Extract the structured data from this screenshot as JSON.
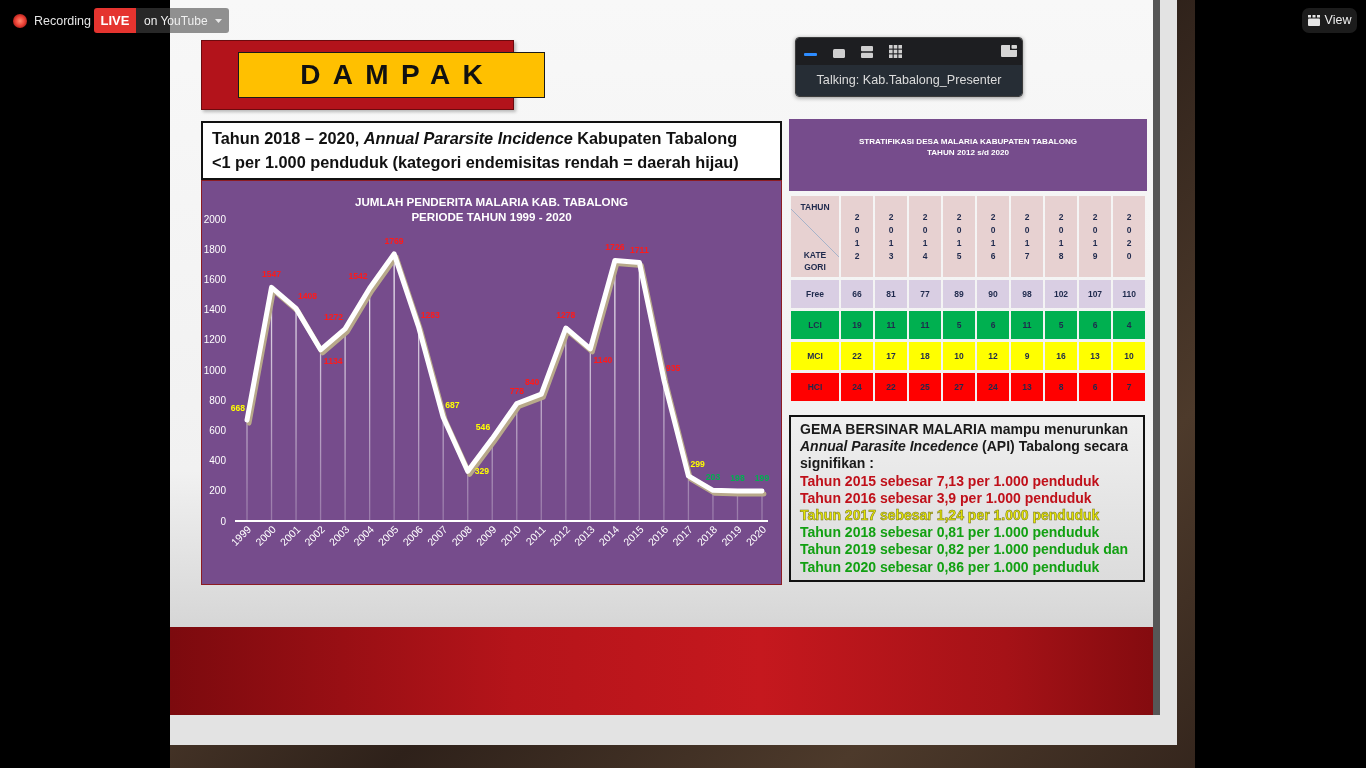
{
  "recording": {
    "label": "Recording"
  },
  "live_stream": {
    "badge": "LIVE",
    "destination": "on YouTube"
  },
  "view_menu": {
    "label": "View"
  },
  "speaker_panel": {
    "view_modes": [
      {
        "kind": "minimize",
        "selected": true
      },
      {
        "kind": "speaker",
        "selected": false
      },
      {
        "kind": "strip",
        "selected": false
      },
      {
        "kind": "gallery",
        "selected": false
      }
    ],
    "talking": "Talking: Kab.Tabalong_Presenter"
  },
  "slide": {
    "title": "DAMPAK",
    "subtitle": "Tahun 2018 – 2020, *Annual Pararsite Incidence* Kabupaten Tabalong <1 per 1.000 penduduk (kategori endemisitas rendah = daerah hijau)",
    "chart": {
      "data_labels": [
        {
          "color": "#ffff00"
        },
        {
          "color": "#ff1a1a"
        },
        {
          "color": "#ff1a1a"
        },
        {
          "color": "#ff1a1a"
        },
        {
          "color": "#ff1a1a"
        },
        {
          "color": "#ff1a1a"
        },
        {
          "color": "#ff1a1a"
        },
        {
          "color": "#ff1a1a"
        },
        {
          "color": "#ffff00"
        },
        {
          "color": "#ffff00"
        },
        {
          "color": "#ffff00"
        },
        {
          "color": "#ff1a1a"
        },
        {
          "color": "#ff1a1a"
        },
        {
          "color": "#ff1a1a"
        },
        {
          "color": "#ff1a1a"
        },
        {
          "color": "#ff1a1a"
        },
        {
          "color": "#ff1a1a"
        },
        {
          "color": "#ff1a1a"
        },
        {
          "color": "#ffff00"
        },
        {
          "color": "#00b050"
        },
        {
          "color": "#00b050"
        },
        {
          "color": "#00b050"
        }
      ],
      "chart_data": {
        "type": "line",
        "title": "JUMLAH PENDERITA MALARIA KAB. TABALONG PERIODE TAHUN 1999 - 2020",
        "categories": [
          "1999",
          "2000",
          "2001",
          "2002",
          "2003",
          "2004",
          "2005",
          "2006",
          "2007",
          "2008",
          "2009",
          "2010",
          "2011",
          "2012",
          "2013",
          "2014",
          "2015",
          "2016",
          "2017",
          "2018",
          "2019",
          "2020"
        ],
        "values": [
          668,
          1547,
          1408,
          1134,
          1272,
          1542,
          1769,
          1283,
          687,
          329,
          546,
          778,
          840,
          1278,
          1140,
          1726,
          1711,
          935,
          299,
          203,
          198,
          199
        ],
        "ylim": [
          0,
          2000
        ],
        "yticks": [
          0,
          200,
          400,
          600,
          800,
          1000,
          1200,
          1400,
          1600,
          1800,
          2000
        ],
        "grid": true,
        "data_labels": true
      }
    },
    "stratification": {
      "title": "STRATIFIKASI DESA MALARIA KABUPATEN TABALONG",
      "subtitle": "TAHUN 2012 s/d 2020",
      "corner_top": "TAHUN",
      "corner_bottom": "KATE GORI",
      "years": [
        "2012",
        "2013",
        "2014",
        "2015",
        "2016",
        "2017",
        "2018",
        "2019",
        "2020"
      ],
      "rows": [
        {
          "category": "Free",
          "color": "#d9cee3",
          "cells": [
            "66",
            "81",
            "77",
            "89",
            "90",
            "98",
            "102",
            "107",
            "110"
          ]
        },
        {
          "category": "LCI",
          "color": "#00b050",
          "cells": [
            "19",
            "11",
            "11",
            "5",
            "6",
            "11",
            "5",
            "6",
            "4"
          ]
        },
        {
          "category": "MCI",
          "color": "#ffff00",
          "cells": [
            "22",
            "17",
            "18",
            "10",
            "12",
            "9",
            "16",
            "13",
            "10"
          ]
        },
        {
          "category": "HCI",
          "color": "#ff0000",
          "cells": [
            "24",
            "22",
            "25",
            "27",
            "24",
            "13",
            "8",
            "6",
            "7"
          ]
        }
      ]
    },
    "summary": {
      "intro": "GEMA BERSINAR MALARIA mampu menurunkan *Annual Parasite Incedence* (API) Tabalong secara signifikan :",
      "lines": [
        {
          "text": "Tahun 2015 sebesar 7,13 per 1.000 penduduk",
          "color": "#c0101a",
          "outlined": false
        },
        {
          "text": "Tahun 2016 sebesar 3,9 per 1.000 penduduk",
          "color": "#c0101a",
          "outlined": false
        },
        {
          "text": "Tahun 2017 sebesar 1,24 per 1.000 penduduk",
          "color": "#e8e800",
          "outlined": true
        },
        {
          "text": "Tahun 2018 sebesar 0,81 per 1.000 penduduk",
          "color": "#12a012",
          "outlined": false
        },
        {
          "text": "Tahun 2019 sebesar 0,82 per 1.000 penduduk dan",
          "color": "#12a012",
          "outlined": false
        },
        {
          "text": "Tahun 2020 sebesar 0,86 per 1.000 penduduk",
          "color": "#12a012",
          "outlined": false
        }
      ]
    }
  }
}
